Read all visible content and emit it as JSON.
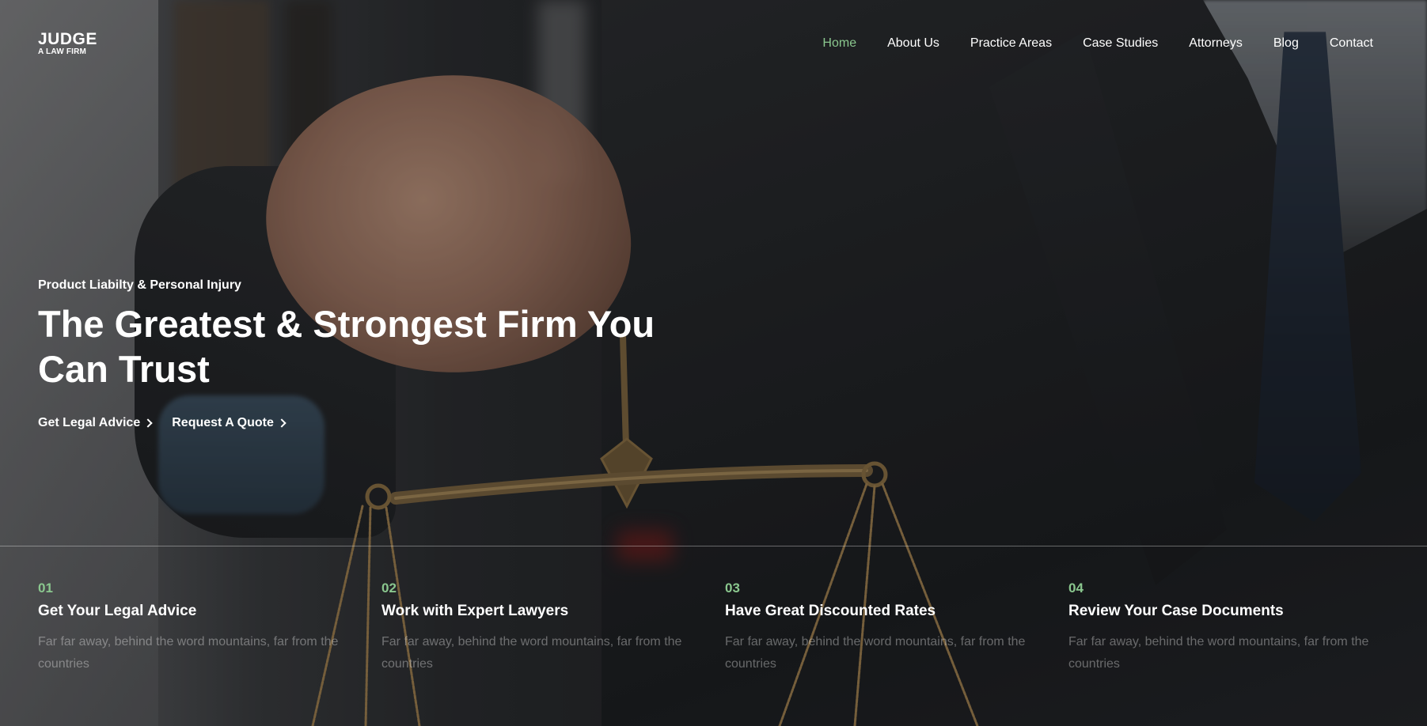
{
  "brand": {
    "name": "JUDGE",
    "tagline": "A LAW FIRM"
  },
  "nav": {
    "items": [
      {
        "label": "Home",
        "active": true
      },
      {
        "label": "About Us",
        "active": false
      },
      {
        "label": "Practice Areas",
        "active": false
      },
      {
        "label": "Case Studies",
        "active": false
      },
      {
        "label": "Attorneys",
        "active": false
      },
      {
        "label": "Blog",
        "active": false
      },
      {
        "label": "Contact",
        "active": false
      }
    ]
  },
  "hero": {
    "eyebrow": "Product Liabilty & Personal Injury",
    "headline": "The Greatest & Strongest Firm You Can Trust",
    "cta_primary": "Get Legal Advice",
    "cta_secondary": "Request A Quote"
  },
  "features": [
    {
      "number": "01",
      "title": "Get Your Legal Advice",
      "text": "Far far away, behind the word mountains, far from the countries"
    },
    {
      "number": "02",
      "title": "Work with Expert Lawyers",
      "text": "Far far away, behind the word mountains, far from the countries"
    },
    {
      "number": "03",
      "title": "Have Great Discounted Rates",
      "text": "Far far away, behind the word mountains, far from the countries"
    },
    {
      "number": "04",
      "title": "Review Your Case Documents",
      "text": "Far far away, behind the word mountains, far from the countries"
    }
  ],
  "colors": {
    "accent": "#8ac78e",
    "text": "#ffffff",
    "muted_text": "rgba(255,255,255,0.35)"
  },
  "icons": {
    "cta_arrow": "chevron-right-icon"
  }
}
